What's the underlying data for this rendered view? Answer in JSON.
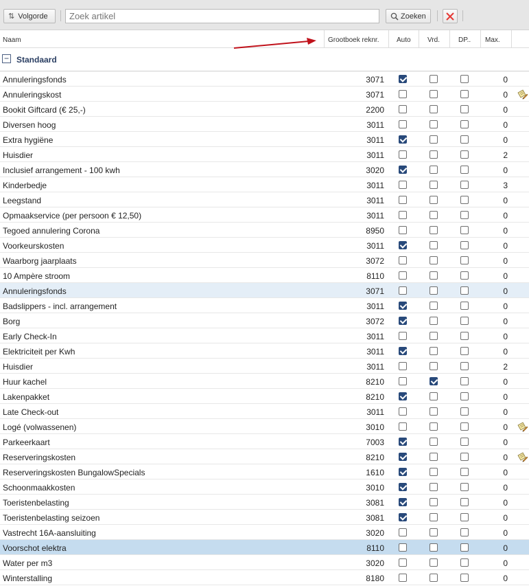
{
  "toolbar": {
    "sort_label": "Volgorde",
    "sort_icon": "sort-arrows-icon",
    "search_placeholder": "Zoek artikel",
    "search_value": "",
    "search_button_label": "Zoeken",
    "search_icon": "search-icon",
    "clear_icon": "close-icon",
    "clear_color": "#e53935"
  },
  "columns": {
    "name": "Naam",
    "ledger": "Grootboek reknr.",
    "auto": "Auto",
    "vrd": "Vrd.",
    "dp": "DP..",
    "max": "Max."
  },
  "group": {
    "label": "Standaard",
    "toggle_icon": "collapse-minus-icon"
  },
  "colors": {
    "accent": "#28497a",
    "group_text": "#2a3e62",
    "row_highlight": "#e4eef7",
    "row_selected": "#c5dcef",
    "annotation_arrow": "#c0121b"
  },
  "rows": [
    {
      "name": "Annuleringsfonds",
      "ledger": "3071",
      "auto": true,
      "vrd": false,
      "dp": false,
      "max": "0",
      "edit": false,
      "state": ""
    },
    {
      "name": "Annuleringskost",
      "ledger": "3071",
      "auto": false,
      "vrd": false,
      "dp": false,
      "max": "0",
      "edit": true,
      "state": ""
    },
    {
      "name": "Bookit Giftcard (€ 25,-)",
      "ledger": "2200",
      "auto": false,
      "vrd": false,
      "dp": false,
      "max": "0",
      "edit": false,
      "state": ""
    },
    {
      "name": "Diversen hoog",
      "ledger": "3011",
      "auto": false,
      "vrd": false,
      "dp": false,
      "max": "0",
      "edit": false,
      "state": ""
    },
    {
      "name": "Extra hygiëne",
      "ledger": "3011",
      "auto": true,
      "vrd": false,
      "dp": false,
      "max": "0",
      "edit": false,
      "state": ""
    },
    {
      "name": "Huisdier",
      "ledger": "3011",
      "auto": false,
      "vrd": false,
      "dp": false,
      "max": "2",
      "edit": false,
      "state": ""
    },
    {
      "name": "Inclusief arrangement - 100 kwh",
      "ledger": "3020",
      "auto": true,
      "vrd": false,
      "dp": false,
      "max": "0",
      "edit": false,
      "state": ""
    },
    {
      "name": "Kinderbedje",
      "ledger": "3011",
      "auto": false,
      "vrd": false,
      "dp": false,
      "max": "3",
      "edit": false,
      "state": ""
    },
    {
      "name": "Leegstand",
      "ledger": "3011",
      "auto": false,
      "vrd": false,
      "dp": false,
      "max": "0",
      "edit": false,
      "state": ""
    },
    {
      "name": "Opmaakservice (per persoon € 12,50)",
      "ledger": "3011",
      "auto": false,
      "vrd": false,
      "dp": false,
      "max": "0",
      "edit": false,
      "state": ""
    },
    {
      "name": "Tegoed annulering Corona",
      "ledger": "8950",
      "auto": false,
      "vrd": false,
      "dp": false,
      "max": "0",
      "edit": false,
      "state": ""
    },
    {
      "name": "Voorkeurskosten",
      "ledger": "3011",
      "auto": true,
      "vrd": false,
      "dp": false,
      "max": "0",
      "edit": false,
      "state": ""
    },
    {
      "name": "Waarborg jaarplaats",
      "ledger": "3072",
      "auto": false,
      "vrd": false,
      "dp": false,
      "max": "0",
      "edit": false,
      "state": ""
    },
    {
      "name": "10 Ampère stroom",
      "ledger": "8110",
      "auto": false,
      "vrd": false,
      "dp": false,
      "max": "0",
      "edit": false,
      "state": ""
    },
    {
      "name": "Annuleringsfonds",
      "ledger": "3071",
      "auto": false,
      "vrd": false,
      "dp": false,
      "max": "0",
      "edit": false,
      "state": "hl-light"
    },
    {
      "name": "Badslippers - incl. arrangement",
      "ledger": "3011",
      "auto": true,
      "vrd": false,
      "dp": false,
      "max": "0",
      "edit": false,
      "state": ""
    },
    {
      "name": "Borg",
      "ledger": "3072",
      "auto": true,
      "vrd": false,
      "dp": false,
      "max": "0",
      "edit": false,
      "state": ""
    },
    {
      "name": "Early Check-In",
      "ledger": "3011",
      "auto": false,
      "vrd": false,
      "dp": false,
      "max": "0",
      "edit": false,
      "state": ""
    },
    {
      "name": "Elektriciteit per Kwh",
      "ledger": "3011",
      "auto": true,
      "vrd": false,
      "dp": false,
      "max": "0",
      "edit": false,
      "state": ""
    },
    {
      "name": "Huisdier",
      "ledger": "3011",
      "auto": false,
      "vrd": false,
      "dp": false,
      "max": "2",
      "edit": false,
      "state": ""
    },
    {
      "name": "Huur kachel",
      "ledger": "8210",
      "auto": false,
      "vrd": true,
      "dp": false,
      "max": "0",
      "edit": false,
      "state": ""
    },
    {
      "name": "Lakenpakket",
      "ledger": "8210",
      "auto": true,
      "vrd": false,
      "dp": false,
      "max": "0",
      "edit": false,
      "state": ""
    },
    {
      "name": "Late Check-out",
      "ledger": "3011",
      "auto": false,
      "vrd": false,
      "dp": false,
      "max": "0",
      "edit": false,
      "state": ""
    },
    {
      "name": "Logé (volwassenen)",
      "ledger": "3010",
      "auto": false,
      "vrd": false,
      "dp": false,
      "max": "0",
      "edit": true,
      "state": ""
    },
    {
      "name": "Parkeerkaart",
      "ledger": "7003",
      "auto": true,
      "vrd": false,
      "dp": false,
      "max": "0",
      "edit": false,
      "state": ""
    },
    {
      "name": "Reserveringskosten",
      "ledger": "8210",
      "auto": true,
      "vrd": false,
      "dp": false,
      "max": "0",
      "edit": true,
      "state": ""
    },
    {
      "name": "Reserveringskosten BungalowSpecials",
      "ledger": "1610",
      "auto": true,
      "vrd": false,
      "dp": false,
      "max": "0",
      "edit": false,
      "state": ""
    },
    {
      "name": "Schoonmaakkosten",
      "ledger": "3010",
      "auto": true,
      "vrd": false,
      "dp": false,
      "max": "0",
      "edit": false,
      "state": ""
    },
    {
      "name": "Toeristenbelasting",
      "ledger": "3081",
      "auto": true,
      "vrd": false,
      "dp": false,
      "max": "0",
      "edit": false,
      "state": ""
    },
    {
      "name": "Toeristenbelasting seizoen",
      "ledger": "3081",
      "auto": true,
      "vrd": false,
      "dp": false,
      "max": "0",
      "edit": false,
      "state": ""
    },
    {
      "name": "Vastrecht 16A-aansluiting",
      "ledger": "3020",
      "auto": false,
      "vrd": false,
      "dp": false,
      "max": "0",
      "edit": false,
      "state": ""
    },
    {
      "name": "Voorschot elektra",
      "ledger": "8110",
      "auto": false,
      "vrd": false,
      "dp": false,
      "max": "0",
      "edit": false,
      "state": "hl-sel"
    },
    {
      "name": "Water per m3",
      "ledger": "3020",
      "auto": false,
      "vrd": false,
      "dp": false,
      "max": "0",
      "edit": false,
      "state": ""
    },
    {
      "name": "Winterstalling",
      "ledger": "8180",
      "auto": false,
      "vrd": false,
      "dp": false,
      "max": "0",
      "edit": false,
      "state": ""
    }
  ]
}
